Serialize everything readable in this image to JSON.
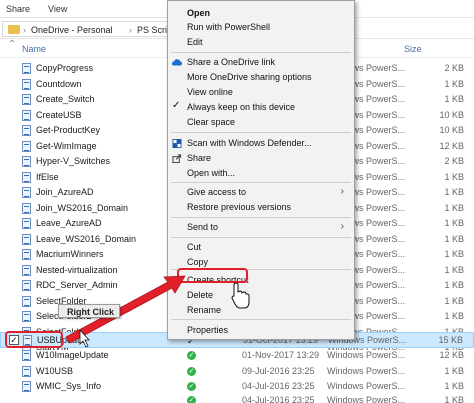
{
  "ribbon": {
    "tabs": [
      "Share",
      "View"
    ]
  },
  "address": {
    "path": [
      "OneDrive - Personal",
      "PS Scripts"
    ],
    "separator": "›"
  },
  "columns": {
    "name": "Name",
    "size": "Size"
  },
  "files": [
    {
      "name": "CopyProgress",
      "type": "Windows PowerS...",
      "size": "2 KB"
    },
    {
      "name": "Countdown",
      "type": "Windows PowerS...",
      "size": "1 KB"
    },
    {
      "name": "Create_Switch",
      "type": "Windows PowerS...",
      "size": "1 KB"
    },
    {
      "name": "CreateUSB",
      "type": "Windows PowerS...",
      "size": "10 KB"
    },
    {
      "name": "Get-ProductKey",
      "type": "Windows PowerS...",
      "size": "10 KB"
    },
    {
      "name": "Get-WimImage",
      "type": "Windows PowerS...",
      "size": "12 KB"
    },
    {
      "name": "Hyper-V_Switches",
      "type": "Windows PowerS...",
      "size": "2 KB"
    },
    {
      "name": "IfElse",
      "type": "Windows PowerS...",
      "size": "1 KB"
    },
    {
      "name": "Join_AzureAD",
      "type": "Windows PowerS...",
      "size": "1 KB"
    },
    {
      "name": "Join_WS2016_Domain",
      "type": "Windows PowerS...",
      "size": "1 KB"
    },
    {
      "name": "Leave_AzureAD",
      "type": "Windows PowerS...",
      "size": "1 KB"
    },
    {
      "name": "Leave_WS2016_Domain",
      "type": "Windows PowerS...",
      "size": "1 KB"
    },
    {
      "name": "MacriumWinners",
      "type": "Windows PowerS...",
      "size": "1 KB"
    },
    {
      "name": "Nested-virtualization",
      "type": "Windows PowerS...",
      "size": "1 KB"
    },
    {
      "name": "RDC_Server_Admin",
      "type": "Windows PowerS...",
      "size": "1 KB"
    },
    {
      "name": "SelectFolder",
      "type": "Windows PowerS...",
      "size": "1 KB"
    },
    {
      "name": "SelectFolder2",
      "type": "Windows PowerS...",
      "size": "1 KB"
    },
    {
      "name": "SelectFolder3",
      "type": "Windows PowerS...",
      "size": "1 KB"
    },
    {
      "name": "StartVM",
      "type": "Windows PowerS...",
      "size": "1 KB"
    },
    {
      "name": "USBUpdate",
      "date": "31-Oct-2017 13:29",
      "type": "Windows PowerS...",
      "size": "15 KB",
      "selected": true
    },
    {
      "name": "W10ImageUpdate",
      "date": "01-Nov-2017 13:29",
      "type": "Windows PowerS...",
      "size": "12 KB"
    },
    {
      "name": "W10USB",
      "date": "09-Jul-2016 23:25",
      "type": "Windows PowerS...",
      "size": "1 KB"
    },
    {
      "name": "WMIC_Sys_Info",
      "date": "04-Jul-2016 23:25",
      "type": "Windows PowerS...",
      "size": "1 KB"
    },
    {
      "name": "",
      "date": "04-Jul-2016 23:25",
      "type": "Windows PowerS...",
      "size": "1 KB"
    }
  ],
  "context_menu": {
    "open": "Open",
    "run_powershell": "Run with PowerShell",
    "edit": "Edit",
    "share_onedrive": "Share a OneDrive link",
    "more_sharing": "More OneDrive sharing options",
    "view_online": "View online",
    "keep_device": "Always keep on this device",
    "clear_space": "Clear space",
    "scan_defender": "Scan with Windows Defender...",
    "share": "Share",
    "open_with": "Open with...",
    "give_access": "Give access to",
    "restore_versions": "Restore previous versions",
    "send_to": "Send to",
    "cut": "Cut",
    "copy": "Copy",
    "create_shortcut": "Create shortcut",
    "delete": "Delete",
    "rename": "Rename",
    "properties": "Properties",
    "submenu_arrow": "›"
  },
  "annotation": {
    "tooltip": "Right Click"
  },
  "colors": {
    "accent_red": "#e0202a",
    "onedrive_blue": "#1a6fd0",
    "status_green": "#2fb34a",
    "selection": "#cce8ff"
  }
}
